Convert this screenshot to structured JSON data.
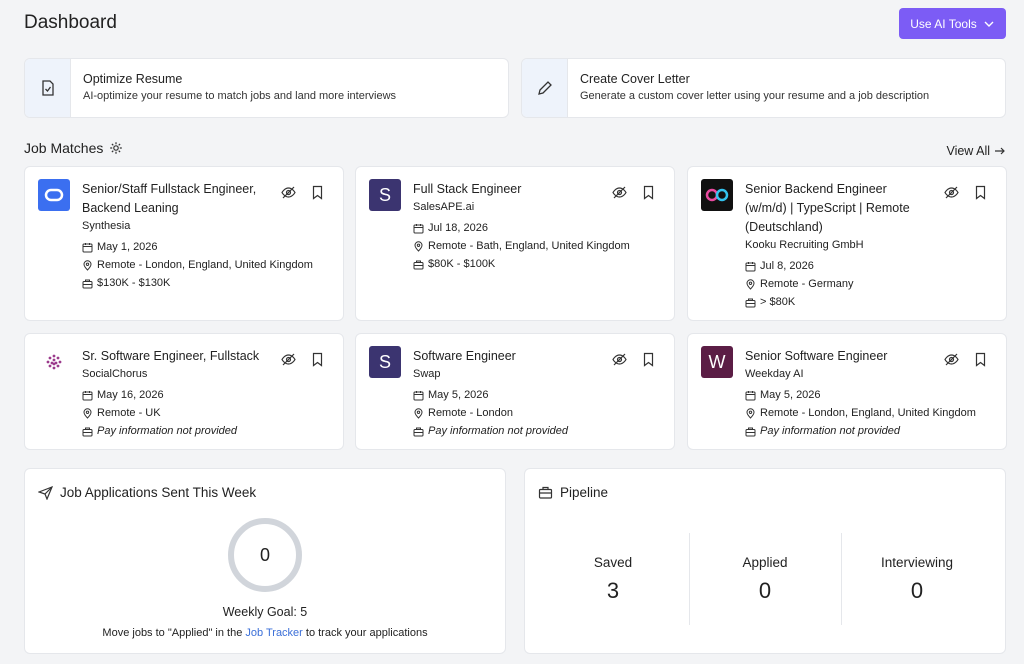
{
  "header": {
    "title": "Dashboard",
    "ai_button": "Use AI Tools"
  },
  "tools": [
    {
      "title": "Optimize Resume",
      "desc": "AI-optimize your resume to match jobs and land more interviews",
      "icon": "resume-check-icon"
    },
    {
      "title": "Create Cover Letter",
      "desc": "Generate a custom cover letter using your resume and a job description",
      "icon": "pencil-icon"
    }
  ],
  "job_matches": {
    "title": "Job Matches",
    "view_all": "View All",
    "jobs": [
      {
        "title_lines": [
          "Senior/Staff Fullstack Engineer,",
          "Backend Leaning"
        ],
        "company": "Synthesia",
        "date": "May 1, 2026",
        "location": "Remote - London, England, United Kingdom",
        "pay": "$130K - $130K",
        "logo_letter": "",
        "logo_color": "#3b6ff0"
      },
      {
        "title_lines": [
          "Full Stack Engineer"
        ],
        "company": "SalesAPE.ai",
        "date": "Jul 18, 2026",
        "location": "Remote - Bath, England, United Kingdom",
        "pay": "$80K - $100K",
        "logo_letter": "S",
        "logo_color": "#3b3470"
      },
      {
        "title_lines": [
          "Senior Backend Engineer",
          "(w/m/d) | TypeScript | Remote",
          "(Deutschland)"
        ],
        "company": "Kooku Recruiting GmbH",
        "date": "Jul 8, 2026",
        "location": "Remote - Germany",
        "pay": "> $80K",
        "logo_letter": "",
        "logo_color": "#111111"
      },
      {
        "title_lines": [
          "Sr. Software Engineer, Fullstack"
        ],
        "company": "SocialChorus",
        "date": "May 16, 2026",
        "location": "Remote - UK",
        "pay": "Pay information not provided",
        "logo_letter": "",
        "logo_color": "#ffffff"
      },
      {
        "title_lines": [
          "Software Engineer"
        ],
        "company": "Swap",
        "date": "May 5, 2026",
        "location": "Remote - London",
        "pay": "Pay information not provided",
        "logo_letter": "S",
        "logo_color": "#3b3470"
      },
      {
        "title_lines": [
          "Senior Software Engineer"
        ],
        "company": "Weekday AI",
        "date": "May 5, 2026",
        "location": "Remote - London, England, United Kingdom",
        "pay": "Pay information not provided",
        "logo_letter": "W",
        "logo_color": "#5b1d45"
      }
    ]
  },
  "applications": {
    "title": "Job Applications Sent This Week",
    "count": "0",
    "goal": "Weekly Goal: 5",
    "hint_before": "Move jobs to \"Applied\" in the ",
    "hint_link": "Job Tracker",
    "hint_after": " to track your applications"
  },
  "pipeline": {
    "title": "Pipeline",
    "columns": [
      {
        "label": "Saved",
        "value": "3"
      },
      {
        "label": "Applied",
        "value": "0"
      },
      {
        "label": "Interviewing",
        "value": "0"
      }
    ]
  }
}
